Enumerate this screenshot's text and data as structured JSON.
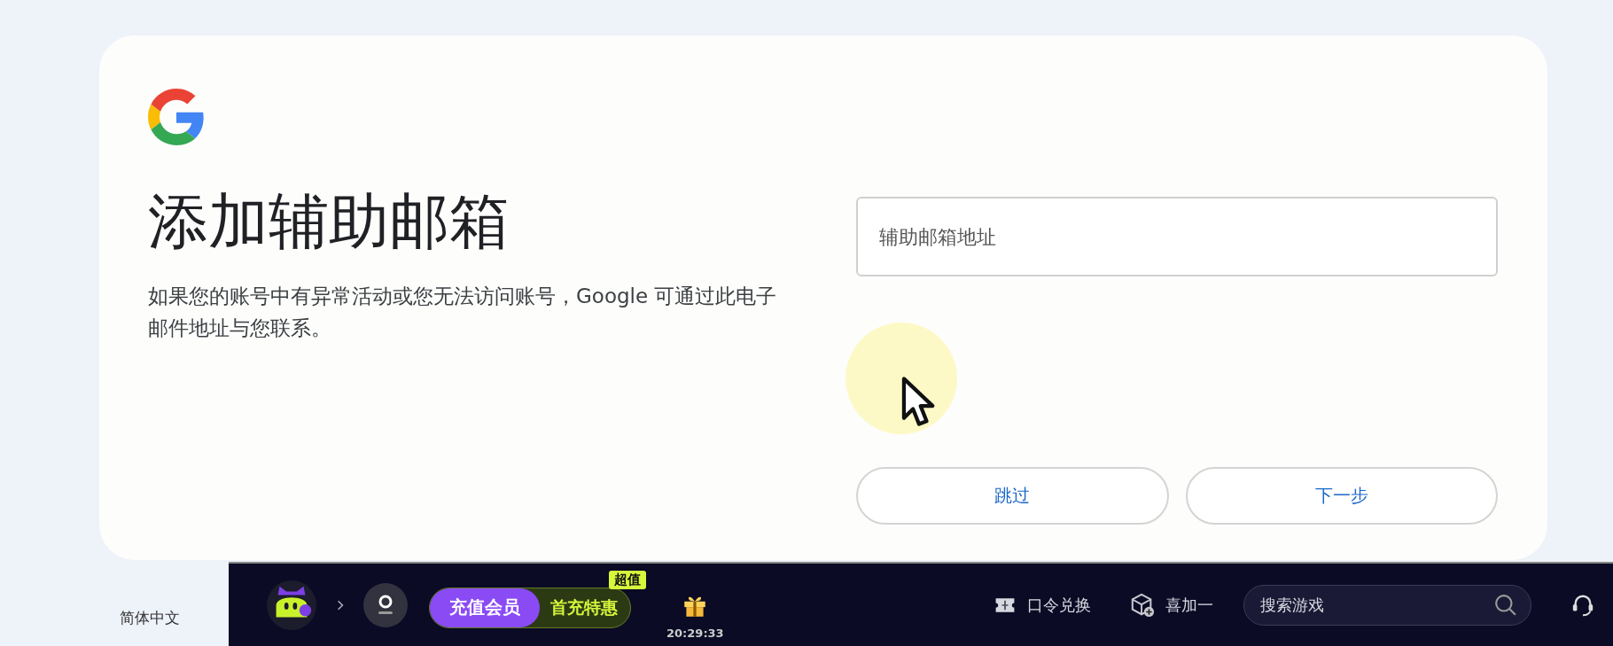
{
  "card": {
    "title": "添加辅助邮箱",
    "description": "如果您的账号中有异常活动或您无法访问账号，Google 可通过此电子邮件地址与您联系。",
    "email_field": {
      "placeholder": "辅助邮箱地址"
    },
    "buttons": [
      {
        "label": "跳过"
      },
      {
        "label": "下一步"
      }
    ]
  },
  "language": "简体中文",
  "taskbar": {
    "vip_button": {
      "label": "充值会员"
    },
    "offer_button": {
      "label": "首充特惠",
      "badge": "超值"
    },
    "gift": {
      "time": "20:29:33"
    },
    "links": [
      {
        "label": "口令兑换",
        "kind": "code"
      },
      {
        "label": "喜加一",
        "kind": "freebie"
      }
    ],
    "search": {
      "placeholder": "搜索游戏"
    }
  }
}
